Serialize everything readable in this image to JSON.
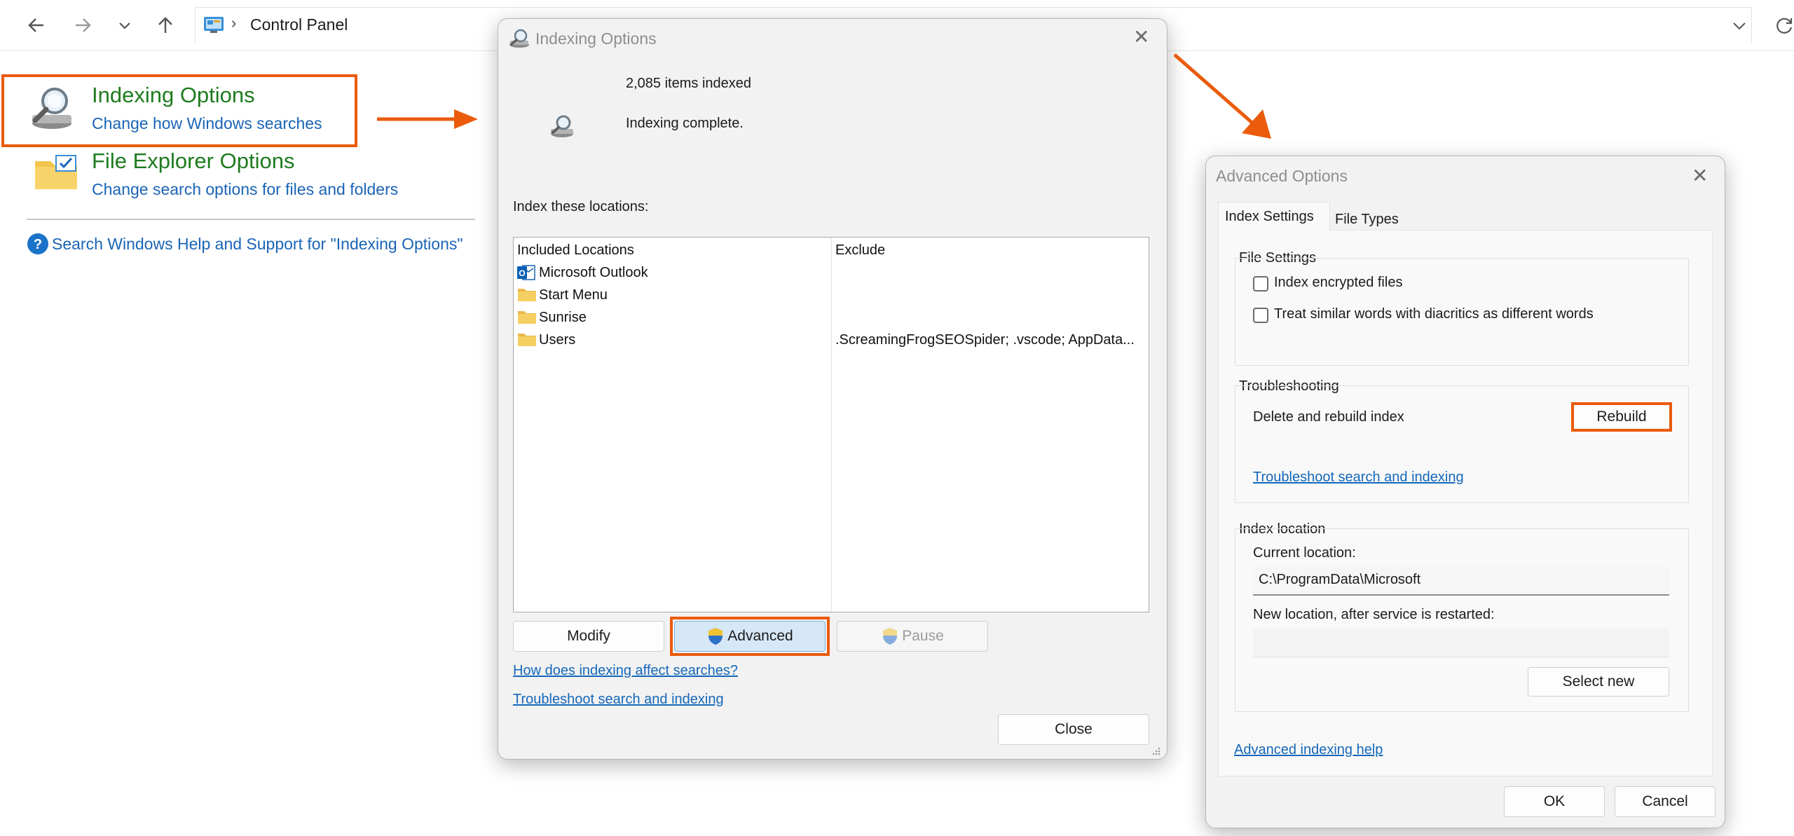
{
  "explorer": {
    "breadcrumb": "Control Panel",
    "breadcrumb_sep": "›"
  },
  "control_panel": {
    "indexing": {
      "title": "Indexing Options",
      "subtitle": "Change how Windows searches"
    },
    "file_explorer": {
      "title": "File Explorer Options",
      "subtitle": "Change search options for files and folders"
    },
    "help_link": "Search Windows Help and Support for \"Indexing Options\""
  },
  "indexing_dialog": {
    "title": "Indexing Options",
    "items_indexed": "2,085 items indexed",
    "status": "Indexing complete.",
    "locations_label": "Index these locations:",
    "columns": {
      "included": "Included Locations",
      "exclude": "Exclude"
    },
    "rows": [
      {
        "name": "Microsoft Outlook",
        "icon": "outlook-icon",
        "exclude": ""
      },
      {
        "name": "Start Menu",
        "icon": "folder-icon",
        "exclude": ""
      },
      {
        "name": "Sunrise",
        "icon": "folder-icon",
        "exclude": ""
      },
      {
        "name": "Users",
        "icon": "folder-icon",
        "exclude": ".ScreamingFrogSEOSpider; .vscode; AppData..."
      }
    ],
    "modify_label": "Modify",
    "advanced_label": "Advanced",
    "pause_label": "Pause",
    "link_affect": "How does indexing affect searches?",
    "link_troubleshoot": "Troubleshoot search and indexing",
    "close_label": "Close"
  },
  "advanced_dialog": {
    "title": "Advanced Options",
    "tabs": [
      "Index Settings",
      "File Types"
    ],
    "file_settings": {
      "heading": "File Settings",
      "encrypt": "Index encrypted files",
      "diacritics": "Treat similar words with diacritics as different words"
    },
    "troubleshooting": {
      "heading": "Troubleshooting",
      "rebuild_text": "Delete and rebuild index",
      "rebuild_label": "Rebuild",
      "link": "Troubleshoot search and indexing"
    },
    "index_location": {
      "heading": "Index location",
      "current_label": "Current location:",
      "current_value": "C:\\ProgramData\\Microsoft",
      "new_label": "New location, after service is restarted:",
      "new_value": "",
      "select_label": "Select new"
    },
    "help_link": "Advanced indexing help",
    "ok_label": "OK",
    "cancel_label": "Cancel"
  },
  "colors": {
    "highlight": "#ea5b0c",
    "cp_green": "#1e7b1e",
    "link_blue": "#1467b9"
  }
}
